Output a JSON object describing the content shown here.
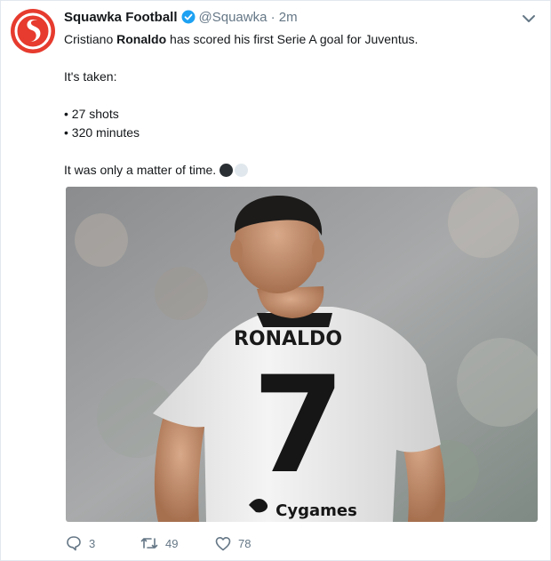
{
  "tweet": {
    "display_name": "Squawka Football",
    "handle": "@Squawka",
    "separator": "·",
    "time": "2m",
    "text_line1_a": "Cristiano ",
    "text_line1_b": "Ronaldo",
    "text_line1_c": " has scored his first Serie A goal for Juventus.",
    "text_line3": "It's taken:",
    "bullet1": "• 27 shots",
    "bullet2": "• 320 minutes",
    "text_last": "It was only a matter of time.",
    "emoji": [
      "black-circle-emoji",
      "white-circle-emoji"
    ]
  },
  "photo": {
    "jersey_name": "RONALDO",
    "jersey_number": "7",
    "sponsor": "Cygames"
  },
  "actions": {
    "replies": "3",
    "retweets": "49",
    "likes": "78"
  },
  "colors": {
    "brand": "#e63b2e",
    "verified": "#1da1f2",
    "muted": "#657786"
  }
}
